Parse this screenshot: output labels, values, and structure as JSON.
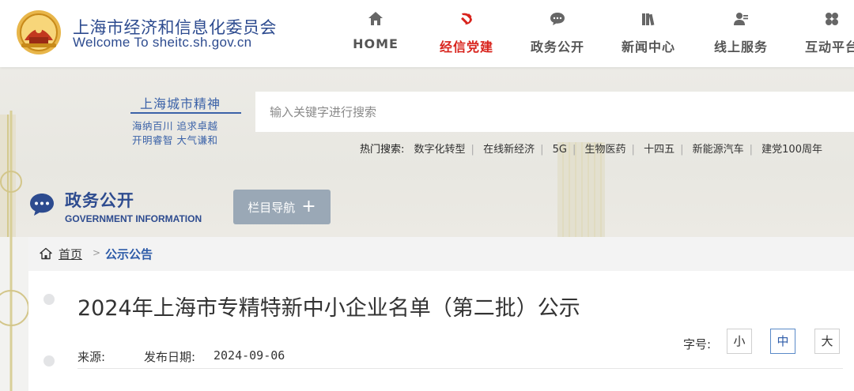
{
  "header": {
    "site_name_cn": "上海市经济和信息化委员会",
    "site_name_en": "Welcome To sheitc.sh.gov.cn",
    "nav": [
      {
        "label": "HOME",
        "icon": "home-icon",
        "active": false
      },
      {
        "label": "经信党建",
        "icon": "hammer-sickle-icon",
        "active": true
      },
      {
        "label": "政务公开",
        "icon": "chat-bubble-icon",
        "active": false
      },
      {
        "label": "新闻中心",
        "icon": "books-icon",
        "active": false
      },
      {
        "label": "线上服务",
        "icon": "user-service-icon",
        "active": false
      },
      {
        "label": "互动平台",
        "icon": "interact-icon",
        "active": false
      }
    ]
  },
  "banner": {
    "slogan_main": "上海城市精神",
    "slogan_line1": "海纳百川 追求卓越",
    "slogan_line2": "开明睿智 大气谦和",
    "search_placeholder": "输入关键字进行搜索",
    "hot_label": "热门搜索:",
    "hot_terms": [
      "数字化转型",
      "在线新经济",
      "5G",
      "生物医药",
      "十四五",
      "新能源汽车",
      "建党100周年"
    ]
  },
  "section": {
    "title_cn": "政务公开",
    "title_en": "GOVERNMENT INFORMATION",
    "column_nav_label": "栏目导航",
    "column_nav_icon": "plus-icon"
  },
  "breadcrumb": {
    "home": "首页",
    "separator": ">",
    "current": "公示公告"
  },
  "article": {
    "title": "2024年上海市专精特新中小企业名单（第二批）公示",
    "source_label": "来源:",
    "source_value": "",
    "date_label": "发布日期:",
    "date_value": "2024-09-06",
    "font_size_label": "字号:",
    "font_sizes": [
      "小",
      "中",
      "大"
    ],
    "font_size_selected": "中"
  },
  "colors": {
    "brand_blue": "#2d4b8f",
    "active_red": "#d8231c",
    "button_gray": "#9aa8b6"
  }
}
